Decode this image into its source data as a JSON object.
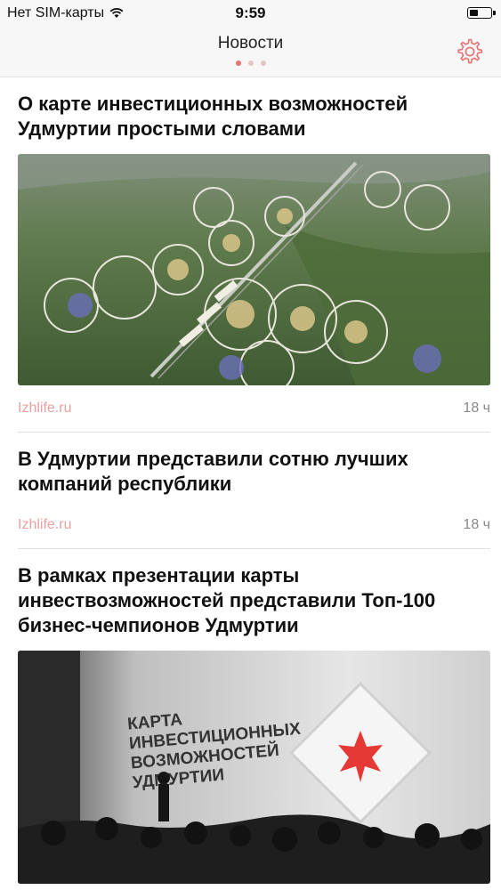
{
  "status": {
    "carrier": "Нет SIM-карты",
    "time": "9:59",
    "battery_level": 0.35
  },
  "nav": {
    "title": "Новости",
    "page_count": 3,
    "active_page": 1,
    "settings_icon": "gear-icon"
  },
  "articles": [
    {
      "title": "О карте инвестиционных возможностей Удмуртии простыми словами",
      "source": "Izhlife.ru",
      "age": "18 ч",
      "image": "aerial-city-plan-illustration"
    },
    {
      "title": "В Удмуртии представили сотню лучших компаний республики",
      "source": "Izhlife.ru",
      "age": "18 ч"
    },
    {
      "title": "В рамках презентации карты инвествозможностей представили Топ-100 бизнес-чемпионов Удмуртии",
      "image": "presentation-stage-photo",
      "image_text": "КАРТА ИНВЕСТИЦИОННЫХ ВОЗМОЖНОСТЕЙ УДМУРТИИ"
    }
  ],
  "colors": {
    "accent": "#e57373",
    "source": "#e8a0a0"
  }
}
